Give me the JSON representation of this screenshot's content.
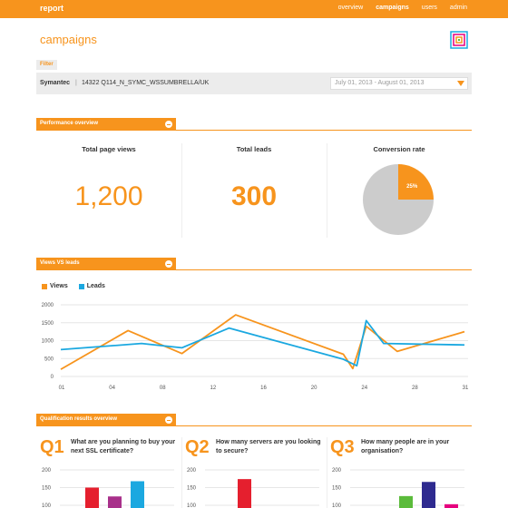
{
  "app": {
    "brand": "report",
    "nav": [
      "overview",
      "campaigns",
      "users",
      "admin"
    ],
    "active_nav": "campaigns",
    "page_title": "campaigns",
    "accent_color": "#f7941d",
    "secondary_color": "#1ba8e0"
  },
  "filter": {
    "tab_label": "Filter",
    "client": "Symantec",
    "separator": "|",
    "campaign": "14322 Q114_N_SYMC_WSSUMBRELLA/UK",
    "date_range": "July 01, 2013 - August 01, 2013"
  },
  "performance": {
    "header": "Performance overview",
    "kpis": [
      {
        "title": "Total page views",
        "value": "1,200"
      },
      {
        "title": "Total leads",
        "value": "300"
      },
      {
        "title": "Conversion rate",
        "value": "25%"
      }
    ]
  },
  "views_leads": {
    "header": "Views VS leads"
  },
  "qualification": {
    "header": "Qualification results overview",
    "questions": [
      {
        "num": "Q1",
        "text": "What are you planning to buy your next SSL certificate?"
      },
      {
        "num": "Q2",
        "text": "How many servers are you looking to secure?"
      },
      {
        "num": "Q3",
        "text": "How many people are in your organisation?"
      }
    ]
  },
  "chart_data": [
    {
      "type": "pie",
      "title": "Conversion rate",
      "slices": [
        {
          "label": "25%",
          "value": 25,
          "color": "#f7941d"
        },
        {
          "label": "",
          "value": 75,
          "color": "#cccccc"
        }
      ]
    },
    {
      "type": "line",
      "title": "Views VS leads",
      "x": [
        1,
        6,
        10,
        14,
        22,
        23,
        24,
        26,
        31
      ],
      "x_ticks": [
        "01",
        "04",
        "08",
        "12",
        "16",
        "20",
        "24",
        "28",
        "31"
      ],
      "ylim": [
        0,
        2000
      ],
      "y_ticks": [
        0,
        500,
        1000,
        1500,
        2000
      ],
      "grid": true,
      "legend_position": "top-left",
      "series": [
        {
          "name": "Views",
          "color": "#f7941d",
          "points": [
            [
              1,
              200
            ],
            [
              6,
              1280
            ],
            [
              10,
              640
            ],
            [
              14,
              1720
            ],
            [
              22,
              620
            ],
            [
              22.7,
              220
            ],
            [
              23.7,
              1400
            ],
            [
              26,
              700
            ],
            [
              31,
              1250
            ]
          ]
        },
        {
          "name": "Leads",
          "color": "#1ba8e0",
          "points": [
            [
              1,
              750
            ],
            [
              7,
              920
            ],
            [
              10,
              800
            ],
            [
              13.5,
              1350
            ],
            [
              22,
              480
            ],
            [
              23,
              300
            ],
            [
              23.7,
              1560
            ],
            [
              25,
              920
            ],
            [
              31,
              880
            ]
          ]
        }
      ]
    },
    {
      "type": "bar",
      "title": "Q1",
      "ylim": [
        0,
        200
      ],
      "y_ticks": [
        100,
        150,
        200
      ],
      "series": [
        {
          "values": [
            150,
            125,
            168
          ],
          "colors": [
            "#e51f2e",
            "#a8308a",
            "#1ba8e0"
          ]
        }
      ]
    },
    {
      "type": "bar",
      "title": "Q2",
      "ylim": [
        0,
        200
      ],
      "y_ticks": [
        100,
        150,
        200
      ],
      "series": [
        {
          "values": [
            174
          ],
          "colors": [
            "#e51f2e"
          ]
        }
      ]
    },
    {
      "type": "bar",
      "title": "Q3",
      "ylim": [
        0,
        200
      ],
      "y_ticks": [
        100,
        150,
        200
      ],
      "series": [
        {
          "values": [
            126,
            166,
            103
          ],
          "colors": [
            "#5bbb3b",
            "#2e2a8f",
            "#e6007e"
          ]
        }
      ]
    }
  ]
}
